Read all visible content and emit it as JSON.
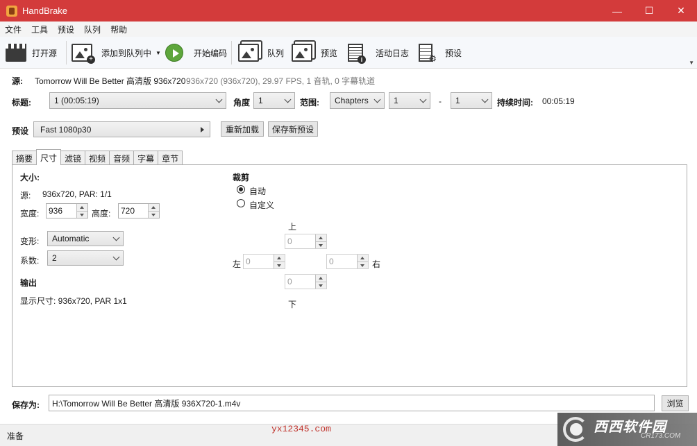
{
  "window": {
    "title": "HandBrake",
    "controls": [
      "—",
      "☐",
      "✕"
    ]
  },
  "menu": [
    "文件",
    "工具",
    "预设",
    "队列",
    "帮助"
  ],
  "toolbar": {
    "open_source": "打开源",
    "add_to_queue": "添加到队列中",
    "start_encode": "开始编码",
    "queue": "队列",
    "preview": "预览",
    "activity_log": "活动日志",
    "presets": "预设"
  },
  "source": {
    "label": "源:",
    "name": "Tomorrow Will Be Better 高清版 936x720",
    "details": "936x720 (936x720), 29.97 FPS, 1 音轨, 0 字幕轨道"
  },
  "title_row": {
    "title_label": "标题:",
    "title_value": "1 (00:05:19)",
    "angle_label": "角度",
    "angle_value": "1",
    "range_label": "范围:",
    "range_type": "Chapters",
    "range_start": "1",
    "range_dash": "-",
    "range_end": "1",
    "duration_label": "持续时间:",
    "duration_value": "00:05:19"
  },
  "preset_row": {
    "label": "预设",
    "value": "Fast 1080p30",
    "reload": "重新加载",
    "save_new": "保存新预设"
  },
  "tabs": [
    "摘要",
    "尺寸",
    "滤镜",
    "视频",
    "音频",
    "字幕",
    "章节"
  ],
  "dimensions": {
    "size_heading": "大小:",
    "source_label": "源:",
    "source_value": "936x720, PAR: 1/1",
    "width_label": "宽度:",
    "width_value": "936",
    "height_label": "高度:",
    "height_value": "720",
    "anamorphic_label": "变形:",
    "anamorphic_value": "Automatic",
    "modulus_label": "系数:",
    "modulus_value": "2",
    "output_heading": "输出",
    "display_size": "显示尺寸:  936x720,  PAR 1x1"
  },
  "cropping": {
    "heading": "裁剪",
    "auto": "自动",
    "custom": "自定义",
    "top_label": "上",
    "bottom_label": "下",
    "left_label": "左",
    "right_label": "右",
    "top": "0",
    "bottom": "0",
    "left": "0",
    "right": "0"
  },
  "save": {
    "label": "保存为:",
    "path": "H:\\Tomorrow Will Be Better 高清版 936X720-1.m4v",
    "browse": "浏览"
  },
  "status": {
    "text": "准备"
  },
  "watermark": {
    "url": "yx12345.com",
    "brand": "西西软件园",
    "brand_sub": "CR173.COM"
  },
  "colors": {
    "titlebar": "#d33b3b",
    "play": "#5ea63c",
    "watermark": "#c0322b"
  }
}
